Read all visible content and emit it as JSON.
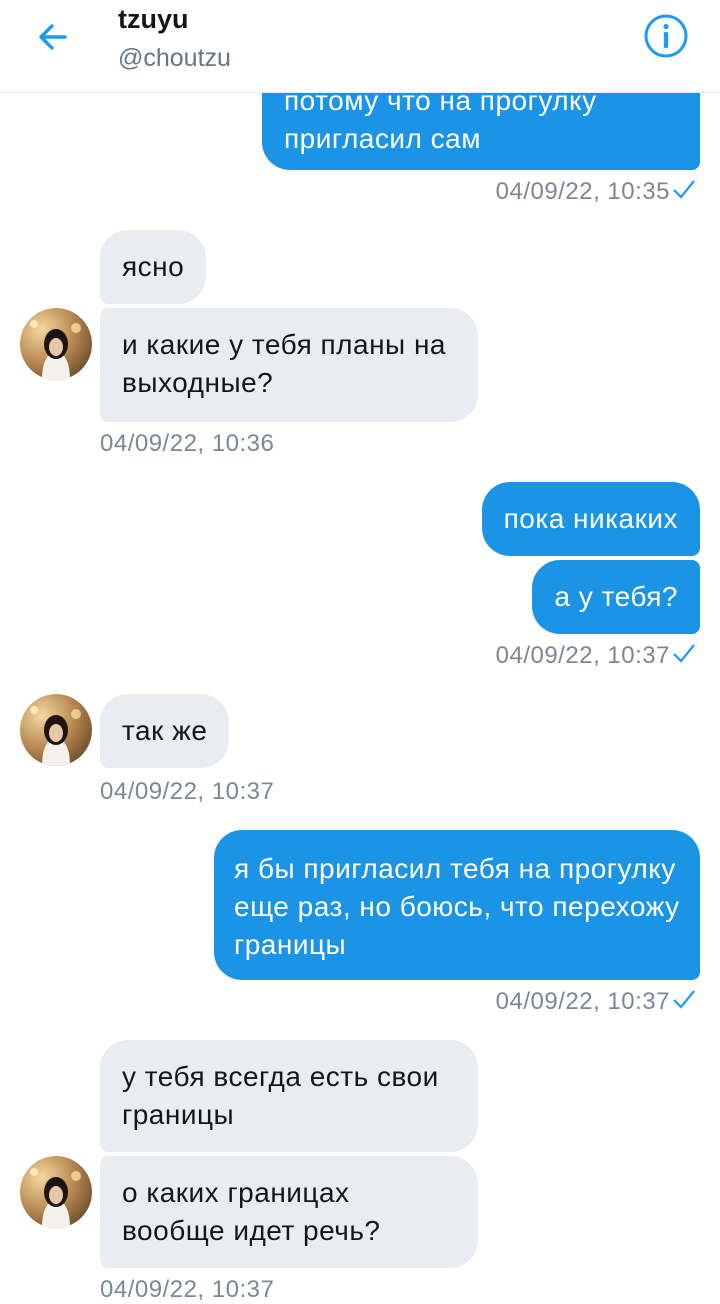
{
  "header": {
    "name": "tzuyu",
    "handle": "@choutzu",
    "back_icon": "arrow-left-icon",
    "info_icon": "info-icon",
    "accent": "#1d9bf0"
  },
  "messages": {
    "m1": {
      "text": "потому что на прогулку пригласил сам",
      "direction": "outgoing"
    },
    "t1": {
      "text": "04/09/22, 10:35"
    },
    "m2": {
      "text": "ясно",
      "direction": "incoming"
    },
    "m3": {
      "text": "и какие у тебя планы на выходные?",
      "direction": "incoming"
    },
    "t2": {
      "text": "04/09/22, 10:36"
    },
    "m4": {
      "text": "пока никаких",
      "direction": "outgoing"
    },
    "m5": {
      "text": "а у тебя?",
      "direction": "outgoing"
    },
    "t3": {
      "text": "04/09/22, 10:37"
    },
    "m6": {
      "text": "так же",
      "direction": "incoming"
    },
    "t4": {
      "text": "04/09/22, 10:37"
    },
    "m7": {
      "text": "я бы пригласил тебя на прогулку еще раз, но боюсь, что перехожу границы",
      "direction": "outgoing"
    },
    "t5": {
      "text": "04/09/22, 10:37"
    },
    "m8": {
      "text": "у тебя всегда есть свои границы",
      "direction": "incoming"
    },
    "m9": {
      "text": "о каких границах вообще идет речь?",
      "direction": "incoming"
    },
    "t6": {
      "text": "04/09/22, 10:37"
    }
  },
  "colors": {
    "outgoing_bubble": "#1c94e6",
    "incoming_bubble": "#e9ecf1",
    "timestamp": "#7b8794",
    "read_check": "#1d9bf0"
  }
}
